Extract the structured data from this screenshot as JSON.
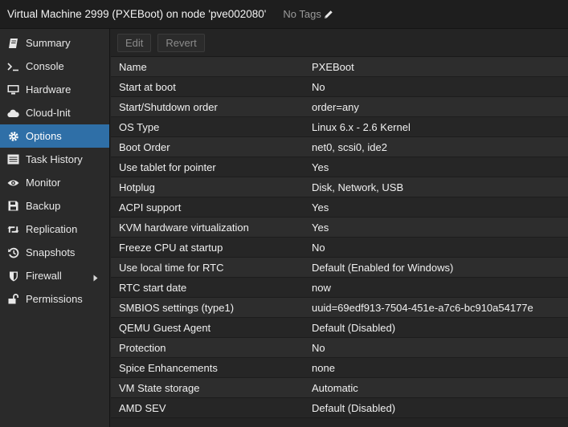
{
  "header": {
    "title": "Virtual Machine 2999 (PXEBoot) on node 'pve002080'",
    "tags_label": "No Tags"
  },
  "sidebar": {
    "items": [
      {
        "label": "Summary",
        "icon": "book-icon"
      },
      {
        "label": "Console",
        "icon": "terminal-icon"
      },
      {
        "label": "Hardware",
        "icon": "desktop-icon"
      },
      {
        "label": "Cloud-Init",
        "icon": "cloud-icon"
      },
      {
        "label": "Options",
        "icon": "gear-icon"
      },
      {
        "label": "Task History",
        "icon": "list-icon"
      },
      {
        "label": "Monitor",
        "icon": "eye-icon"
      },
      {
        "label": "Backup",
        "icon": "floppy-icon"
      },
      {
        "label": "Replication",
        "icon": "retweet-icon"
      },
      {
        "label": "Snapshots",
        "icon": "history-icon"
      },
      {
        "label": "Firewall",
        "icon": "shield-icon"
      },
      {
        "label": "Permissions",
        "icon": "unlock-icon"
      }
    ],
    "active": "Options"
  },
  "toolbar": {
    "edit_label": "Edit",
    "revert_label": "Revert"
  },
  "options": [
    {
      "key": "Name",
      "value": "PXEBoot"
    },
    {
      "key": "Start at boot",
      "value": "No"
    },
    {
      "key": "Start/Shutdown order",
      "value": "order=any"
    },
    {
      "key": "OS Type",
      "value": "Linux 6.x - 2.6 Kernel"
    },
    {
      "key": "Boot Order",
      "value": "net0, scsi0, ide2"
    },
    {
      "key": "Use tablet for pointer",
      "value": "Yes"
    },
    {
      "key": "Hotplug",
      "value": "Disk, Network, USB"
    },
    {
      "key": "ACPI support",
      "value": "Yes"
    },
    {
      "key": "KVM hardware virtualization",
      "value": "Yes"
    },
    {
      "key": "Freeze CPU at startup",
      "value": "No"
    },
    {
      "key": "Use local time for RTC",
      "value": "Default (Enabled for Windows)"
    },
    {
      "key": "RTC start date",
      "value": "now"
    },
    {
      "key": "SMBIOS settings (type1)",
      "value": "uuid=69edf913-7504-451e-a7c6-bc910a54177e"
    },
    {
      "key": "QEMU Guest Agent",
      "value": "Default (Disabled)"
    },
    {
      "key": "Protection",
      "value": "No"
    },
    {
      "key": "Spice Enhancements",
      "value": "none"
    },
    {
      "key": "VM State storage",
      "value": "Automatic"
    },
    {
      "key": "AMD SEV",
      "value": "Default (Disabled)"
    }
  ],
  "colors": {
    "accent": "#2f6fa7",
    "background": "#242424"
  }
}
